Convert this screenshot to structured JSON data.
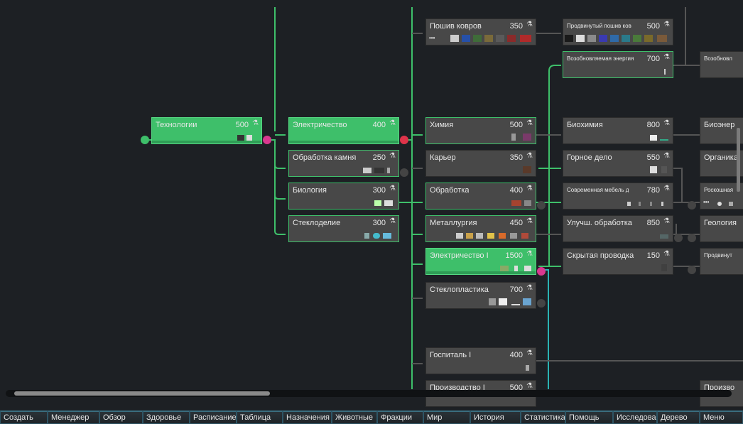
{
  "nodes": [
    {
      "id": "tech",
      "label": "Технологии",
      "cost": "500",
      "state": "done"
    },
    {
      "id": "elec",
      "label": "Электричество",
      "cost": "400",
      "state": "done"
    },
    {
      "id": "stone",
      "label": "Обработка камня",
      "cost": "250",
      "state": "avail"
    },
    {
      "id": "bio",
      "label": "Биология",
      "cost": "300",
      "state": "avail"
    },
    {
      "id": "glass",
      "label": "Стеклоделие",
      "cost": "300",
      "state": "avail"
    },
    {
      "id": "carpet",
      "label": "Пошив ковров",
      "cost": "350",
      "state": "normal"
    },
    {
      "id": "chem",
      "label": "Химия",
      "cost": "500",
      "state": "avail"
    },
    {
      "id": "quarry",
      "label": "Карьер",
      "cost": "350",
      "state": "normal"
    },
    {
      "id": "proc",
      "label": "Обработка",
      "cost": "400",
      "state": "avail"
    },
    {
      "id": "metal",
      "label": "Металлургия",
      "cost": "450",
      "state": "avail"
    },
    {
      "id": "elec1",
      "label": "Электричество I",
      "cost": "1500",
      "state": "done"
    },
    {
      "id": "fiber",
      "label": "Стеклопластика",
      "cost": "700",
      "state": "normal"
    },
    {
      "id": "hosp",
      "label": "Госпиталь I",
      "cost": "400",
      "state": "normal"
    },
    {
      "id": "prod",
      "label": "Производство I",
      "cost": "500",
      "state": "normal"
    },
    {
      "id": "adv_carpet",
      "label": "Продвинутый пошив ков",
      "cost": "500",
      "state": "normal"
    },
    {
      "id": "renew",
      "label": "Возобновляемая энергия",
      "cost": "700",
      "state": "avail"
    },
    {
      "id": "biochem",
      "label": "Биохимия",
      "cost": "800",
      "state": "normal"
    },
    {
      "id": "mining",
      "label": "Горное дело",
      "cost": "550",
      "state": "normal"
    },
    {
      "id": "furniture",
      "label": "Современная мебель д",
      "cost": "780",
      "state": "normal"
    },
    {
      "id": "impproc",
      "label": "Улучш. обработка",
      "cost": "850",
      "state": "normal"
    },
    {
      "id": "wiring",
      "label": "Скрытая проводка",
      "cost": "150",
      "state": "normal"
    },
    {
      "id": "renew2",
      "label": "Возобновл",
      "cost": "",
      "state": "normal"
    },
    {
      "id": "bioen",
      "label": "Биоэнер",
      "cost": "",
      "state": "normal"
    },
    {
      "id": "organ",
      "label": "Органика",
      "cost": "",
      "state": "normal"
    },
    {
      "id": "luxury",
      "label": "Роскошная",
      "cost": "",
      "state": "normal"
    },
    {
      "id": "geol",
      "label": "Геология",
      "cost": "",
      "state": "normal"
    },
    {
      "id": "advanced",
      "label": "Продвинут",
      "cost": "",
      "state": "normal"
    },
    {
      "id": "prod2",
      "label": "Произво",
      "cost": "",
      "state": "normal"
    }
  ],
  "tabs": [
    "Создать",
    "Менеджер",
    "Обзор",
    "Здоровье",
    "Расписание",
    "Таблица",
    "Назначения",
    "Животные",
    "Фракции",
    "Мир",
    "История",
    "Статистика",
    "Помощь",
    "Исследования",
    "Дерево",
    "Меню"
  ],
  "colors": {
    "done": "#3ebf6a",
    "link": "#3ebf6a",
    "link_cyan": "#2ab3b3",
    "dot_magenta": "#d9388f",
    "dot_red": "#e0344a",
    "node": "#484848",
    "bg": "#1d2024"
  },
  "icons": {
    "cost_icon": "flask-icon"
  }
}
